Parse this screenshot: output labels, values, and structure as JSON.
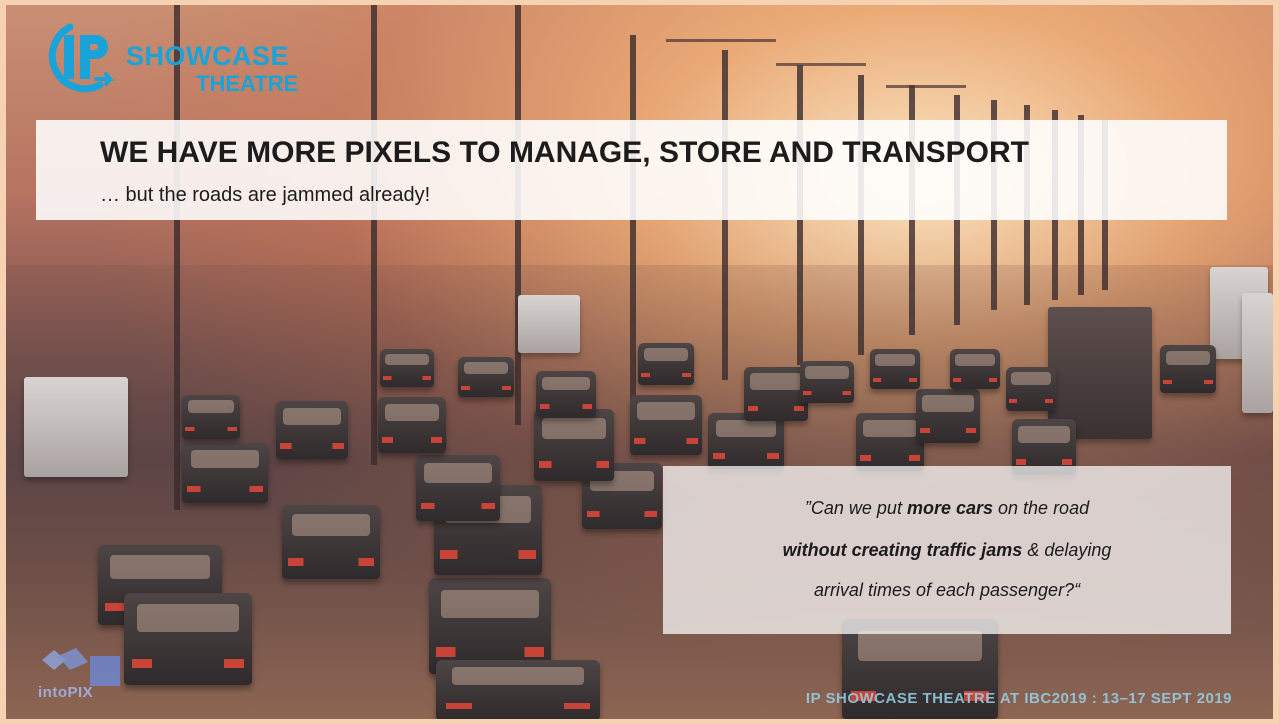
{
  "logo": {
    "line1": "SHOWCASE",
    "line2": "THEATRE",
    "monogram": "IP",
    "color": "#1aa3d8"
  },
  "title_box": {
    "title": "WE HAVE MORE PIXELS TO MANAGE, STORE AND TRANSPORT",
    "subtitle": "… but the roads are jammed already!"
  },
  "quote": {
    "line1_pre": "”Can we put ",
    "line1_bold": "more cars",
    "line1_post": " on the road",
    "line2_bold": "without creating traffic jams",
    "line2_post": " & delaying",
    "line3": "arrival times of each passenger?“"
  },
  "footer": {
    "text": "IP SHOWCASE THEATRE AT IBC2019 : 13–17 SEPT 2019"
  },
  "intopix_logo": {
    "text": "intoPIX",
    "color": "#8fa6e0"
  },
  "background": {
    "description_icon": "highway-traffic-photo"
  }
}
